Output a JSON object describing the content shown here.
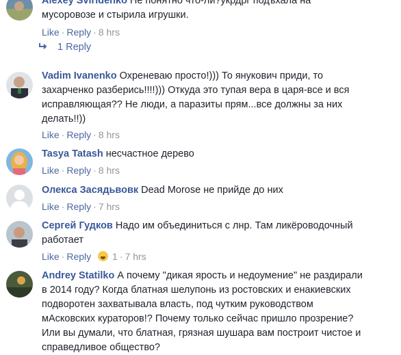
{
  "comments": [
    {
      "author": "Alexey Sviridenko",
      "text_lines": [
        "Не понятно что-ли?укрдрг подъхала на",
        "мусоровозе и стырила игрушки."
      ],
      "like": "Like",
      "reply": "Reply",
      "time": "8 hrs",
      "replies_label": "1 Reply"
    },
    {
      "author": "Vadim Ivanenko",
      "text_lines": [
        "Охреневаю просто!))) То янукович приди, то",
        "захарченко разберись!!!!))) Откуда это тупая вера в царя-все и вся",
        "исправляющая?? Не люди, а паразиты прям...все должны за них",
        "делать!!))"
      ],
      "like": "Like",
      "reply": "Reply",
      "time": "8 hrs"
    },
    {
      "author": "Tasya Tatash",
      "text_lines": [
        "несчастное дерево"
      ],
      "like": "Like",
      "reply": "Reply",
      "time": "8 hrs"
    },
    {
      "author": "Олекса Засядьвовк",
      "text_lines": [
        "Dead Morose не прийде до них"
      ],
      "like": "Like",
      "reply": "Reply",
      "time": "7 hrs"
    },
    {
      "author": "Сергей Гудков",
      "text_lines": [
        "Надо им объединиться с лнр. Там ликёроводочный",
        "работает"
      ],
      "like": "Like",
      "reply": "Reply",
      "time": "7 hrs",
      "reaction_count": "1"
    },
    {
      "author": "Andrey Statilko",
      "text_lines": [
        "А почему \"дикая ярость и недоумение\" не раздирали",
        "в 2014 году? Когда блатная шелупонь из ростовских и енакиевских",
        "подворотен захватывала власть, под чутким руководством",
        "мАсковских кураторов!? Почему только сейчас пришло прозрение?",
        "Или вы думали, что блатная, грязная шушара вам построит чистое и",
        "справедливое общество?"
      ]
    }
  ]
}
